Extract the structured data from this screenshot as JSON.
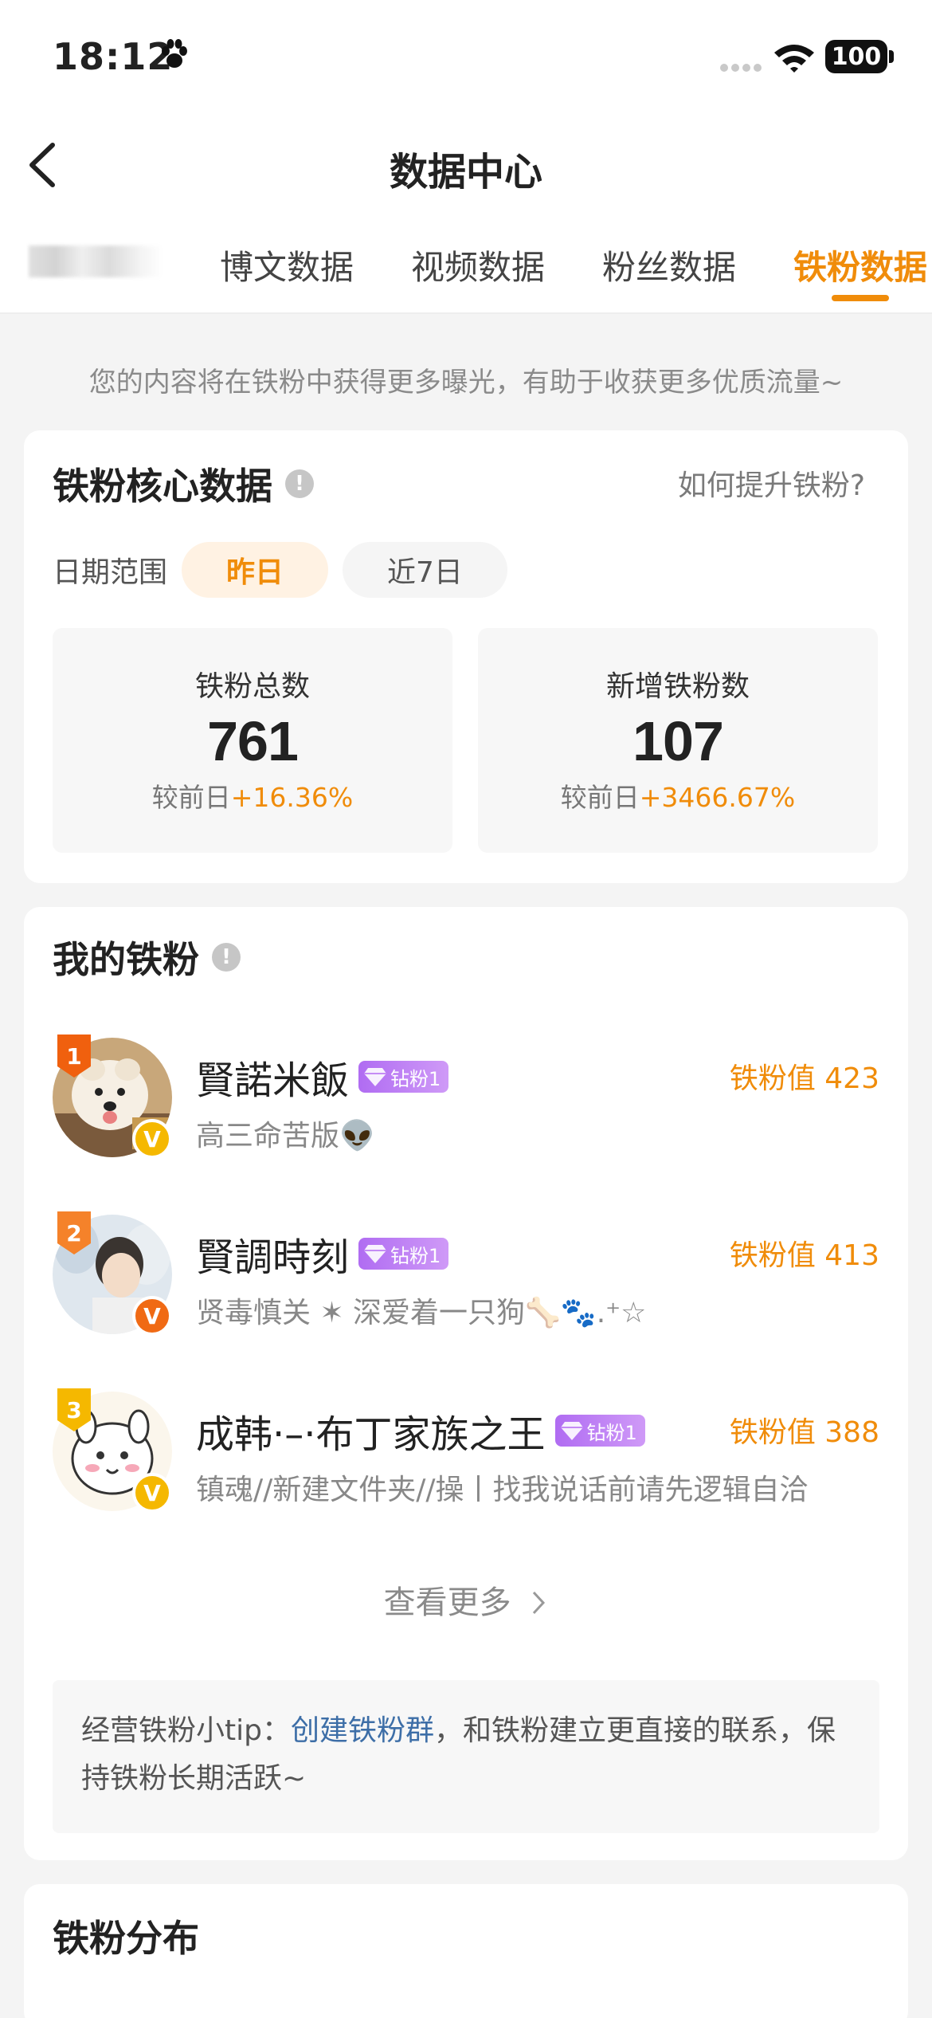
{
  "status_bar": {
    "time": "18:12",
    "battery": "100"
  },
  "nav": {
    "title": "数据中心"
  },
  "tabs": [
    {
      "label": "博文数据",
      "active": false
    },
    {
      "label": "视频数据",
      "active": false
    },
    {
      "label": "粉丝数据",
      "active": false
    },
    {
      "label": "铁粉数据",
      "active": true
    }
  ],
  "notice": "您的内容将在铁粉中获得更多曝光，有助于收获更多优质流量~",
  "core": {
    "title": "铁粉核心数据",
    "info_glyph": "!",
    "help_link": "如何提升铁粉?",
    "date_range_label": "日期范围",
    "date_options": [
      "昨日",
      "近7日"
    ],
    "selected_date": "昨日",
    "stats": [
      {
        "label": "铁粉总数",
        "value": "761",
        "compare_prefix": "较前日",
        "change": "+16.36%"
      },
      {
        "label": "新增铁粉数",
        "value": "107",
        "compare_prefix": "较前日",
        "change": "+3466.67%"
      }
    ]
  },
  "my_fans": {
    "title": "我的铁粉",
    "info_glyph": "!",
    "items": [
      {
        "rank": "1",
        "name": "賢諾米飯",
        "level": "钻粉1",
        "bio": "高三命苦版👽",
        "score_label": "铁粉值",
        "score": "423",
        "badge": "V",
        "badge_color": "#f5b800"
      },
      {
        "rank": "2",
        "name": "賢調時刻",
        "level": "钻粉1",
        "bio": "贤毒慎关 ✶ 深爱着一只狗🦴🐾.⁺☆",
        "score_label": "铁粉值",
        "score": "413",
        "badge": "V",
        "badge_color": "#f06a14"
      },
      {
        "rank": "3",
        "name": "成韩·–·布丁家族之王",
        "level": "钻粉1",
        "bio": "镇魂//新建文件夹//操丨找我说话前请先逻辑自洽",
        "score_label": "铁粉值",
        "score": "388",
        "badge": "V",
        "badge_color": "#f5b800"
      }
    ],
    "more": "查看更多",
    "tip_prefix": "经营铁粉小tip：",
    "tip_link": "创建铁粉群",
    "tip_suffix": "，和铁粉建立更直接的联系，保持铁粉长期活跃~"
  },
  "distribution": {
    "title": "铁粉分布"
  },
  "colors": {
    "accent": "#f08c0a",
    "link": "#3d6ea7",
    "rank_1": "#f0600e",
    "rank_2": "#f5822a",
    "rank_3": "#f5b800"
  }
}
